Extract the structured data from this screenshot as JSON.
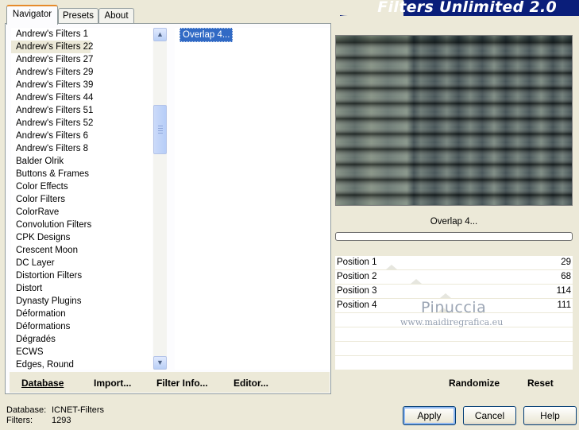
{
  "tabs": [
    {
      "label": "Navigator",
      "active": true
    },
    {
      "label": "Presets",
      "active": false
    },
    {
      "label": "About",
      "active": false
    }
  ],
  "banner": {
    "title": "Filters Unlimited 2.0",
    "color": "#0a1e7a"
  },
  "categories": {
    "selected_index": 1,
    "items": [
      "Andrew's Filters 1",
      "Andrew's Filters 22",
      "Andrew's Filters 27",
      "Andrew's Filters 29",
      "Andrew's Filters 39",
      "Andrew's Filters 44",
      "Andrew's Filters 51",
      "Andrew's Filters 52",
      "Andrew's Filters 6",
      "Andrew's Filters 8",
      "Balder Olrik",
      "Buttons & Frames",
      "Color Effects",
      "Color Filters",
      "ColorRave",
      "Convolution Filters",
      "CPK Designs",
      "Crescent Moon",
      "DC Layer",
      "Distortion Filters",
      "Distort",
      "Dynasty Plugins",
      "Déformation",
      "Déformations",
      "Dégradés",
      "ECWS",
      "Edges, Round"
    ]
  },
  "filters": {
    "items": [
      "Overlap 4..."
    ],
    "selected": "Overlap 4..."
  },
  "left_toolbar": {
    "database": "Database",
    "import": "Import...",
    "filter_info": "Filter Info...",
    "editor": "Editor..."
  },
  "preview": {
    "filter_name": "Overlap 4..."
  },
  "params": [
    {
      "label": "Position 1",
      "value": "29",
      "level": 29
    },
    {
      "label": "Position 2",
      "value": "68",
      "level": 68
    },
    {
      "label": "Position 3",
      "value": "114",
      "level": 114
    },
    {
      "label": "Position 4",
      "value": "111",
      "level": 111
    }
  ],
  "watermark": {
    "name": "Pinuccia",
    "url": "www.maidiregrafica.eu"
  },
  "right_toolbar": {
    "randomize": "Randomize",
    "reset": "Reset"
  },
  "status": {
    "database_label": "Database:",
    "database_value": "ICNET-Filters",
    "filters_label": "Filters:",
    "filters_value": "1293"
  },
  "dialog_buttons": {
    "apply": "Apply",
    "cancel": "Cancel",
    "help": "Help"
  }
}
